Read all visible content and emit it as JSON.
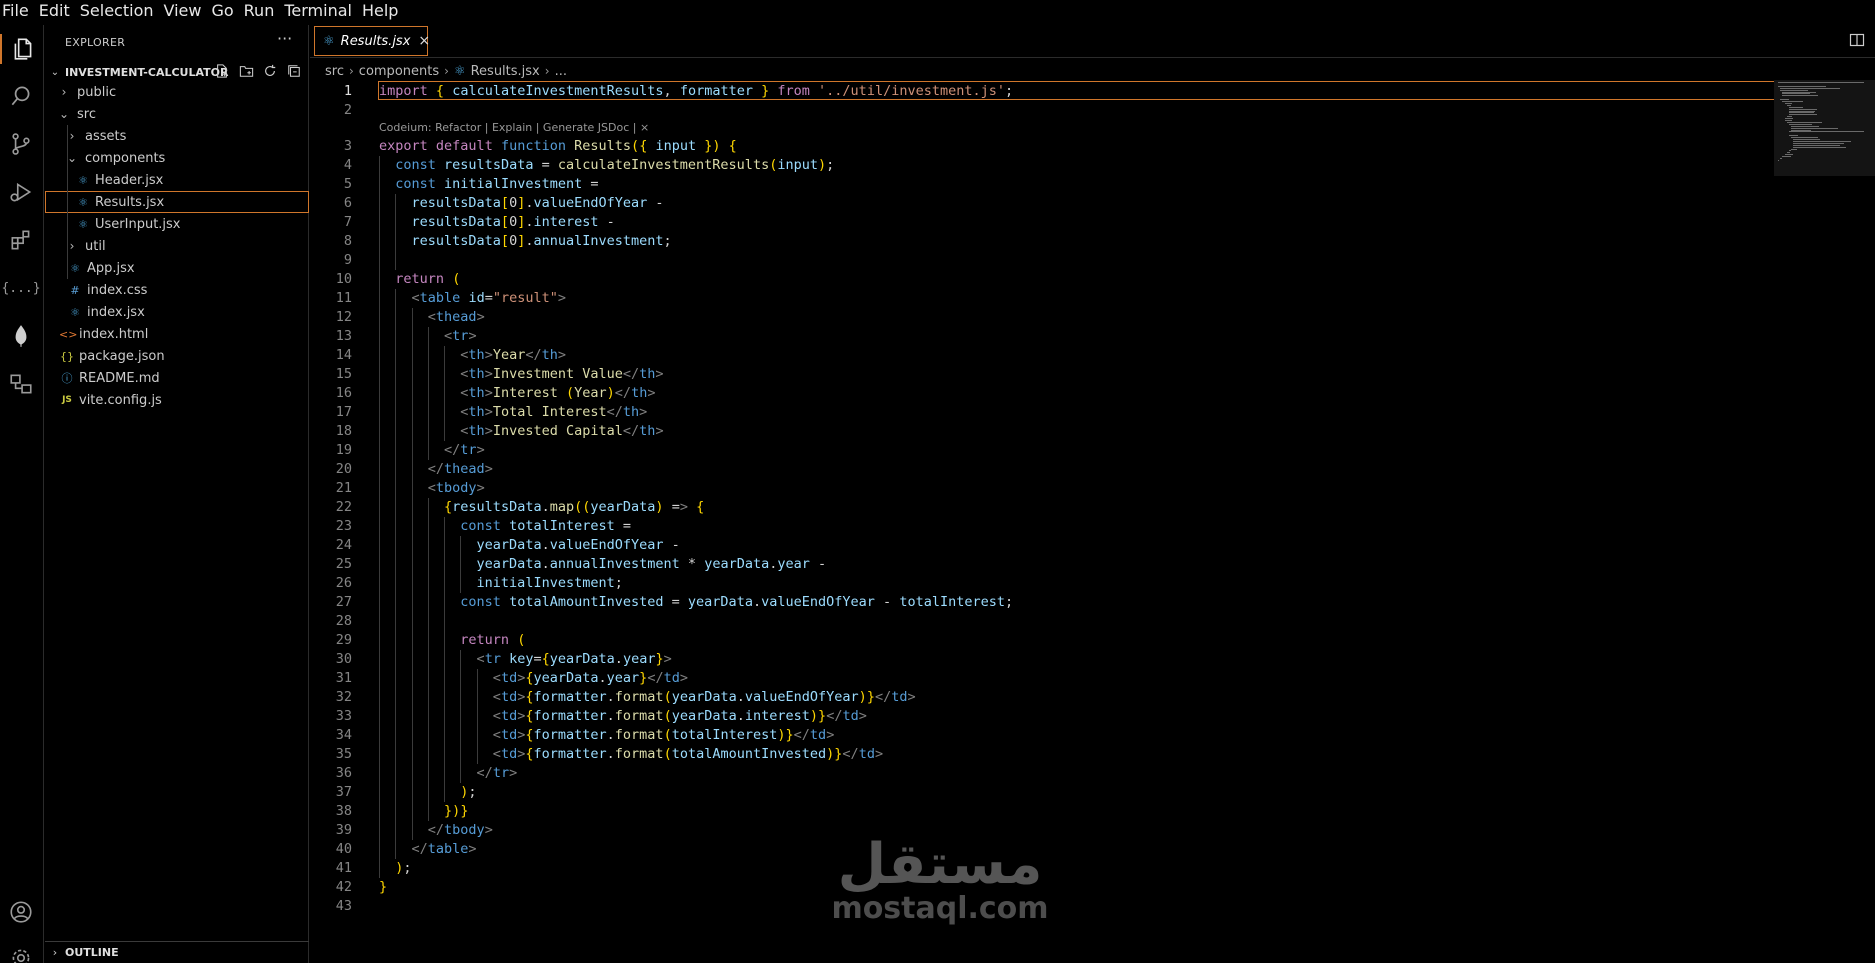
{
  "menu": [
    "File",
    "Edit",
    "Selection",
    "View",
    "Go",
    "Run",
    "Terminal",
    "Help"
  ],
  "explorer": {
    "title": "EXPLORER",
    "more": "···",
    "project": "INVESTMENT-CALCULATOR",
    "tree": [
      {
        "label": "public",
        "kind": "folder",
        "expanded": false
      },
      {
        "label": "src",
        "kind": "folder",
        "expanded": true
      },
      {
        "label": "assets",
        "kind": "folder",
        "expanded": false
      },
      {
        "label": "components",
        "kind": "folder",
        "expanded": true
      },
      {
        "label": "Header.jsx",
        "kind": "react"
      },
      {
        "label": "Results.jsx",
        "kind": "react",
        "selected": true
      },
      {
        "label": "UserInput.jsx",
        "kind": "react"
      },
      {
        "label": "util",
        "kind": "folder",
        "expanded": false
      },
      {
        "label": "App.jsx",
        "kind": "react"
      },
      {
        "label": "index.css",
        "kind": "css"
      },
      {
        "label": "index.jsx",
        "kind": "react"
      },
      {
        "label": "index.html",
        "kind": "html"
      },
      {
        "label": "package.json",
        "kind": "json"
      },
      {
        "label": "README.md",
        "kind": "info"
      },
      {
        "label": "vite.config.js",
        "kind": "js"
      }
    ],
    "outline": "OUTLINE"
  },
  "tab": {
    "label": "Results.jsx",
    "close": "×"
  },
  "breadcrumb": [
    "src",
    "components",
    "Results.jsx",
    "..."
  ],
  "codelens": "Codeium: Refactor | Explain | Generate JSDoc | ×",
  "code_lines": [
    "import { calculateInvestmentResults, formatter } from '../util/investment.js';",
    "",
    "export default function Results({ input }) {",
    "  const resultsData = calculateInvestmentResults(input);",
    "  const initialInvestment =",
    "    resultsData[0].valueEndOfYear -",
    "    resultsData[0].interest -",
    "    resultsData[0].annualInvestment;",
    "",
    "  return (",
    "    <table id=\"result\">",
    "      <thead>",
    "        <tr>",
    "          <th>Year</th>",
    "          <th>Investment Value</th>",
    "          <th>Interest (Year)</th>",
    "          <th>Total Interest</th>",
    "          <th>Invested Capital</th>",
    "        </tr>",
    "      </thead>",
    "      <tbody>",
    "        {resultsData.map((yearData) => {",
    "          const totalInterest =",
    "            yearData.valueEndOfYear -",
    "            yearData.annualInvestment * yearData.year -",
    "            initialInvestment;",
    "          const totalAmountInvested = yearData.valueEndOfYear - totalInterest;",
    "",
    "          return (",
    "            <tr key={yearData.year}>",
    "              <td>{yearData.year}</td>",
    "              <td>{formatter.format(yearData.valueEndOfYear)}</td>",
    "              <td>{formatter.format(yearData.interest)}</td>",
    "              <td>{formatter.format(totalInterest)}</td>",
    "              <td>{formatter.format(totalAmountInvested)}</td>",
    "            </tr>",
    "          );",
    "        })}",
    "      </tbody>",
    "    </table>",
    "  );",
    "}",
    ""
  ],
  "watermark": {
    "arabic": "مستقل",
    "latin": "mostaql.com"
  }
}
